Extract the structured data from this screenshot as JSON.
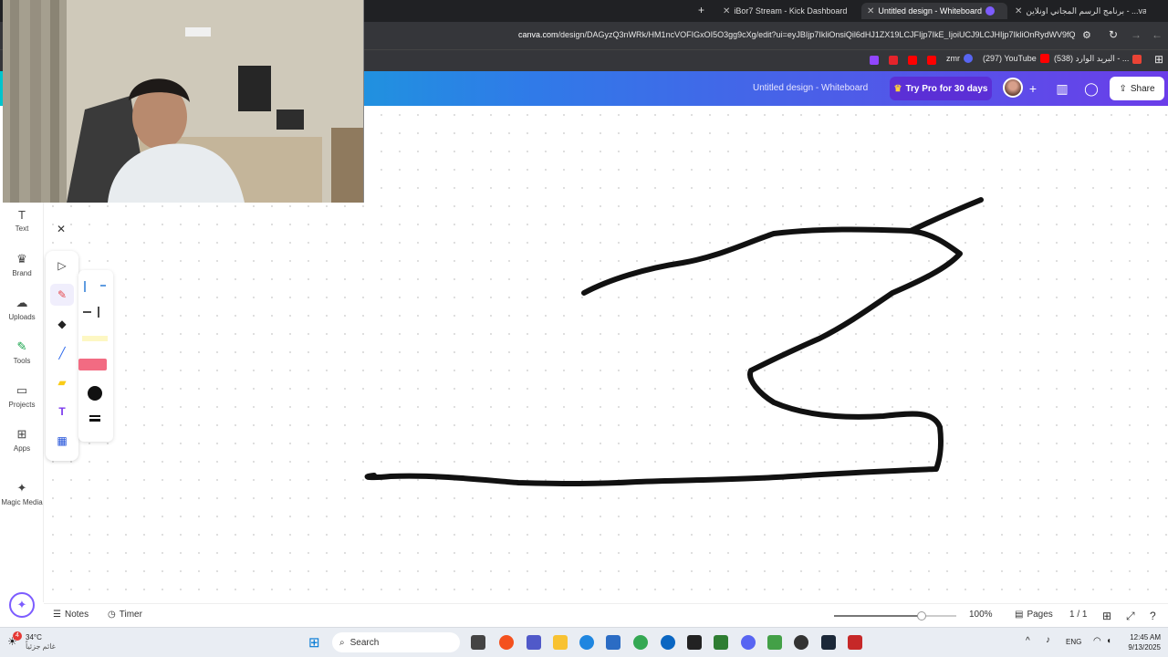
{
  "browser": {
    "tabs": [
      {
        "label": "iBor7 Stream - Kick Dashboard",
        "active": false
      },
      {
        "label": "Untitled design - Whiteboard",
        "active": true
      },
      {
        "label": "برنامج الرسم المجاني اونلاين - ...va",
        "active": false
      }
    ],
    "url_domain": "canva.com",
    "url_path": "/design/DAGyzQ3nWRk/HM1ncVOFIGxOI5O3gg9cXg/edit?ui=eyJBIjp7IkliOnsiQil6dHJ1ZX19LCJFIjp7IkE_IjoiUCJ9LCJHIjp7IkliOnRydWV9fQ",
    "bookmarks": [
      {
        "label": "zmr",
        "color": "#ff3b30"
      },
      {
        "label": "(297) YouTube",
        "color": "#ff0000"
      },
      {
        "label": "(538) البريد الوارد - ...",
        "color": "#ea4335"
      }
    ]
  },
  "canva": {
    "doc_title": "Untitled design - Whiteboard",
    "try_pro": "Try Pro for 30 days",
    "share": "Share"
  },
  "sidebar": {
    "items": [
      {
        "label": "Text",
        "icon": "text-icon",
        "glyph": "T"
      },
      {
        "label": "Brand",
        "icon": "brand-icon",
        "glyph": "♛"
      },
      {
        "label": "Uploads",
        "icon": "cloud-upload-icon",
        "glyph": "☁"
      },
      {
        "label": "Tools",
        "icon": "tools-icon",
        "glyph": "✎"
      },
      {
        "label": "Projects",
        "icon": "folder-icon",
        "glyph": "▭"
      },
      {
        "label": "Apps",
        "icon": "apps-icon",
        "glyph": "⊞"
      },
      {
        "label": "Magic Media",
        "icon": "magic-media-icon",
        "glyph": "✦"
      }
    ]
  },
  "tool_panel": {
    "close": "✕",
    "tools": [
      {
        "name": "select-tool",
        "glyph": "▷"
      },
      {
        "name": "pen-tool",
        "glyph": "✎"
      },
      {
        "name": "shapes-tool",
        "glyph": "◆"
      },
      {
        "name": "line-tool",
        "glyph": "╱"
      },
      {
        "name": "sticky-note-tool",
        "glyph": "▰"
      },
      {
        "name": "text-tool",
        "glyph": "T"
      },
      {
        "name": "table-tool",
        "glyph": "▦"
      }
    ],
    "pen_colors": {
      "highlighter": "#f26b82",
      "marker": "#111111"
    }
  },
  "bottombar": {
    "notes": "Notes",
    "timer": "Timer",
    "zoom": "100%",
    "zoom_fraction": 0.72,
    "pages": "Pages",
    "page_count": "1 / 1"
  },
  "taskbar": {
    "weather_temp": "34°C",
    "weather_desc": "غائم جزئياً",
    "search": "Search",
    "lang": "ENG",
    "time": "12:45 AM",
    "date": "9/13/2025",
    "notification_count": "4"
  },
  "colors": {
    "header_start": "#00c4cc",
    "header_end": "#6b3de9",
    "try_pro_bg": "#5b2fd6",
    "ink": "#111111"
  }
}
